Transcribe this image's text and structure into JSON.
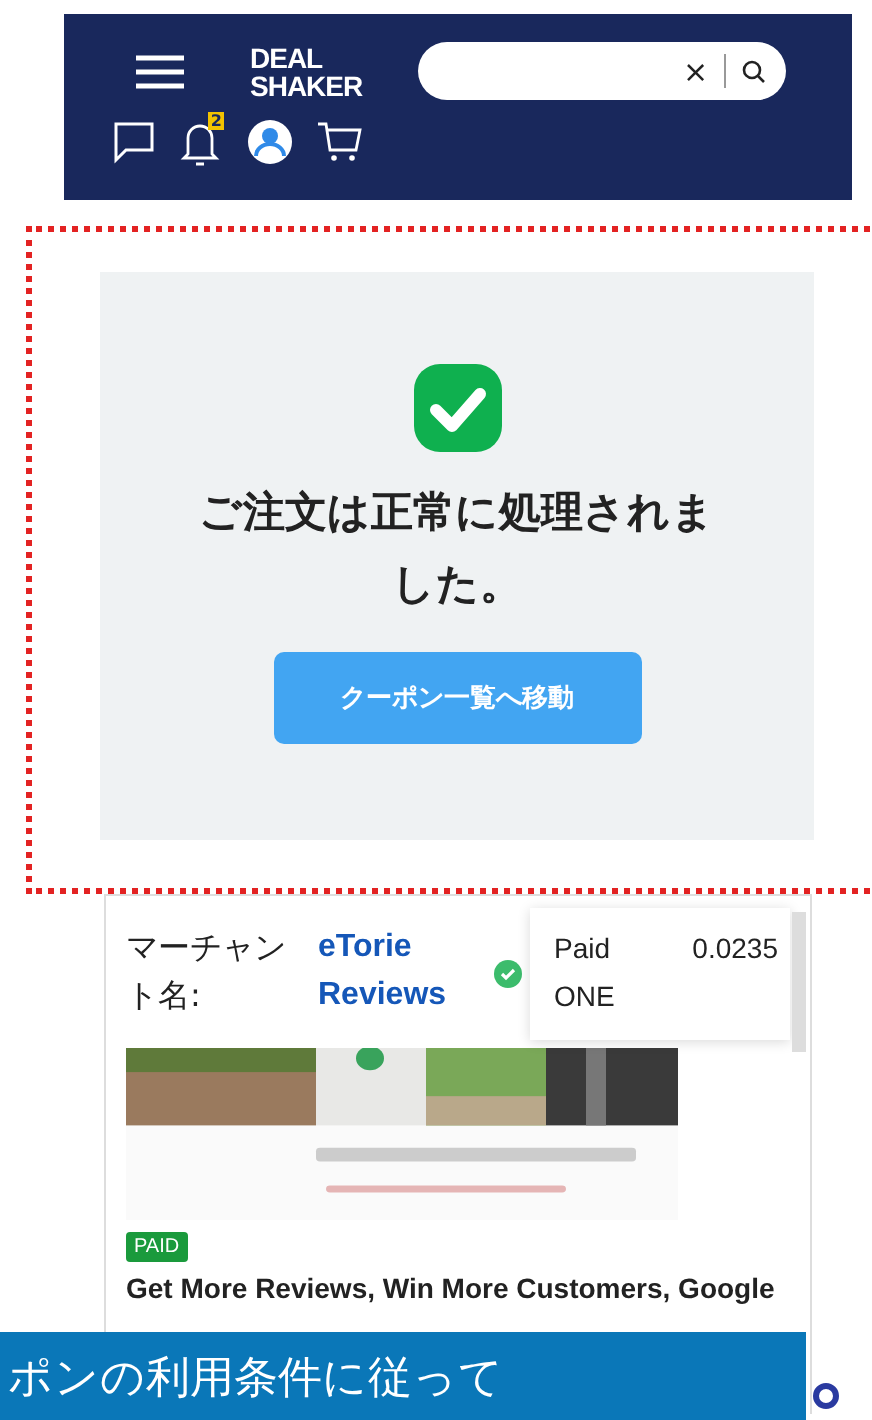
{
  "header": {
    "logo": [
      "DEAL",
      "SHAKER"
    ],
    "search": {
      "clear": "×"
    },
    "notification_count": "2"
  },
  "success": {
    "message": "ご注文は正常に処理されました。",
    "button": "クーポン一覧へ移動"
  },
  "product": {
    "merchant_label": "マーチャント名:",
    "merchant_name": "eTorie Reviews",
    "verified": true,
    "payment_method": "Paid ONE",
    "amount": "0.0235",
    "badge": "PAID",
    "title": "Get More Reviews, Win More Customers, Google"
  },
  "banner": {
    "text": "ポンの利用条件に従って"
  }
}
